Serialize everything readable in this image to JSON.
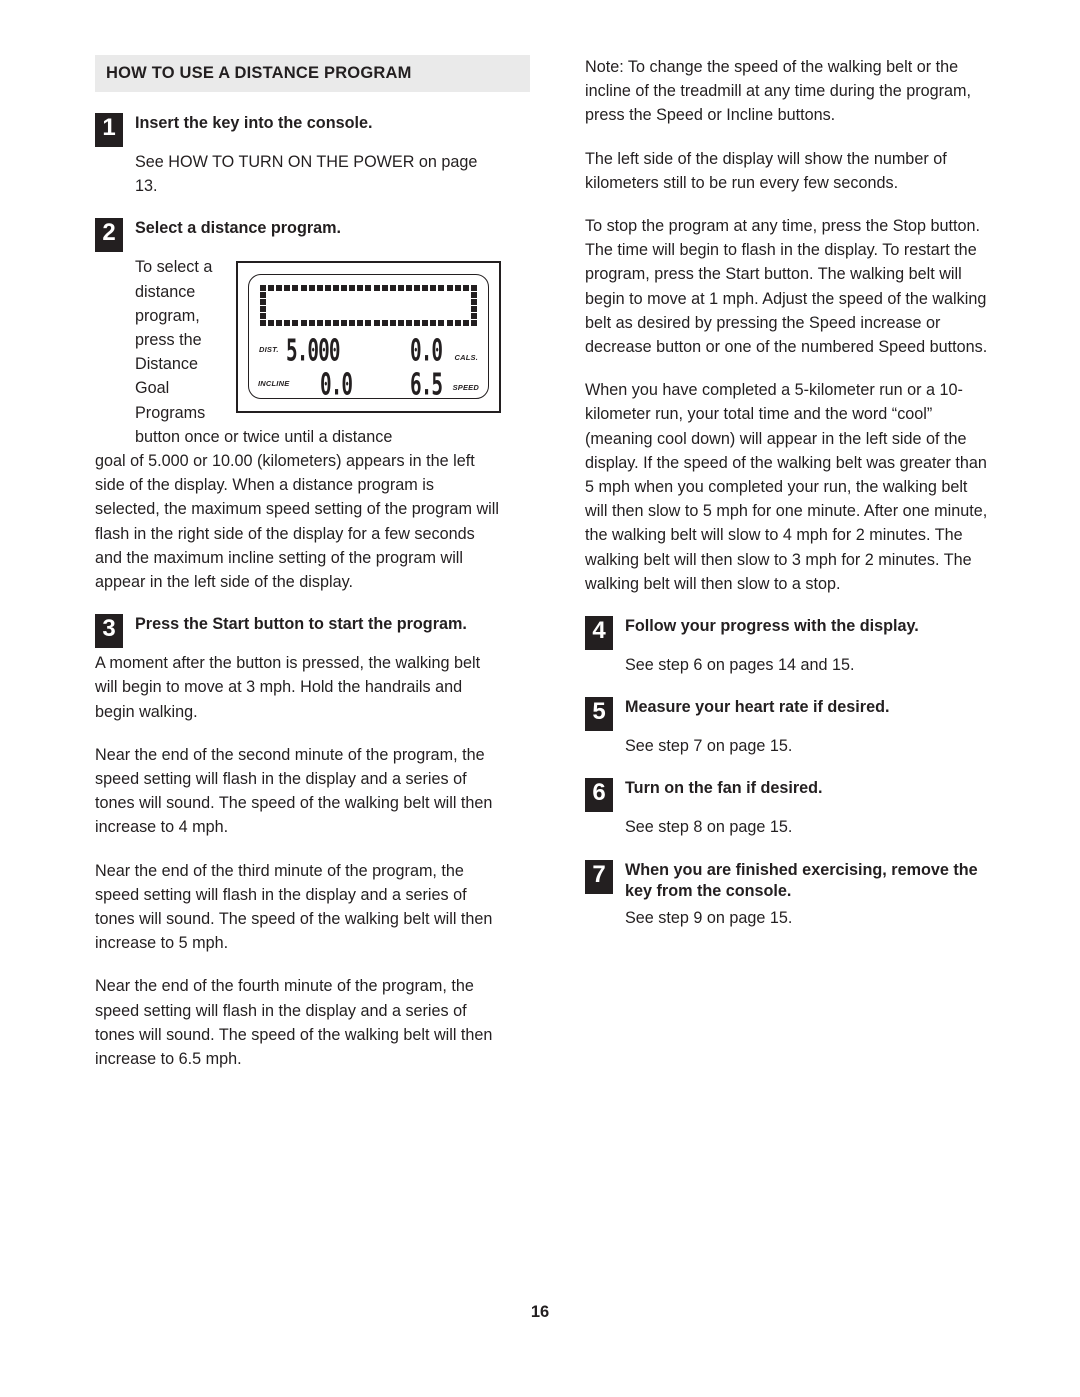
{
  "document": {
    "page_number": "16",
    "section_header": "HOW TO USE A DISTANCE PROGRAM"
  },
  "left_column": {
    "step1": {
      "number": "1",
      "title": "Insert the key into the console.",
      "body": "See HOW TO TURN ON THE POWER on page 13."
    },
    "step2": {
      "number": "2",
      "title": "Select a distance program.",
      "body_wrap": "To select a distance program, press the Distance Goal Programs button once or twice until a distance",
      "body_rest": "goal of 5.000 or 10.00 (kilometers) appears in the left side of the display. When a distance program is selected, the maximum speed setting of the program will flash in the right side of the display for a few seconds and the maximum incline setting of the program will appear in the left side of the display."
    },
    "step3": {
      "number": "3",
      "title": "Press the Start button to start the program.",
      "paragraph1": "A moment after the button is pressed, the walking belt will begin to move at 3 mph. Hold the handrails and begin walking.",
      "paragraph2": "Near the end of the second minute of the program, the speed setting will flash in the display and a series of tones will sound. The speed of the walking belt will then increase to 4 mph.",
      "paragraph3": "Near the end of the third minute of the program, the speed setting will flash in the display and a series of tones will sound. The speed of the walking belt will then increase to 5 mph.",
      "paragraph4": "Near the end of the fourth minute of the program, the speed setting will flash in the display and a series of tones will sound. The speed of the walking belt will then increase to 6.5 mph."
    }
  },
  "console_display": {
    "dist_label": "DIST.",
    "dist_value": "5.000",
    "cals_label": "CALS.",
    "cals_value": "0.0",
    "incline_label": "INCLINE",
    "incline_value": "0.0",
    "speed_label": "SPEED",
    "speed_value": "6.5"
  },
  "right_column": {
    "note": "Note: To change the speed of the walking belt or the incline of the treadmill at any time during the program, press the Speed or Incline buttons.",
    "paragraph_left_side": "The left side of the display will show the number of kilometers still to be run every few seconds.",
    "paragraph_stop": "To stop the program at any time, press the Stop button. The time will begin to flash in the display. To restart the program, press the Start button. The walking belt will begin to move at 1 mph. Adjust the speed of the walking belt as desired by pressing the Speed increase or decrease button or one of the numbered Speed buttons.",
    "paragraph_completed": "When you have completed a 5-kilometer run or a 10-kilometer run, your total time and the word “cool” (meaning cool down) will appear in the left side of the display. If the speed of the walking belt was greater than 5 mph when you completed your run, the walking belt will then slow to 5 mph for one minute. After one minute, the walking belt will slow to 4 mph for 2 minutes. The walking belt will then slow to 3 mph for 2 minutes. The walking belt will then slow to a stop.",
    "step4": {
      "number": "4",
      "title": "Follow your progress with the display.",
      "body": "See step 6 on pages 14 and 15."
    },
    "step5": {
      "number": "5",
      "title": "Measure your heart rate if desired.",
      "body": "See step 7 on page 15."
    },
    "step6": {
      "number": "6",
      "title": "Turn on the fan if desired.",
      "body": "See step 8 on page 15."
    },
    "step7": {
      "number": "7",
      "title": "When you are finished exercising, remove the key from the console.",
      "body": "See step 9 on page 15."
    }
  },
  "colors": {
    "ink": "#231f20",
    "header_background": "#eaeaea",
    "page_background": "#ffffff"
  }
}
